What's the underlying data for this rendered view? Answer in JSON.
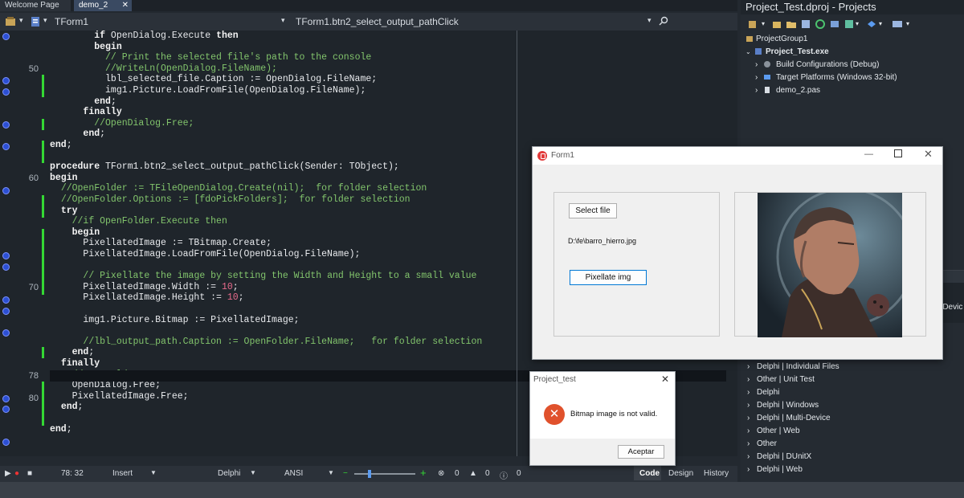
{
  "tabs": {
    "welcome": "Welcome Page",
    "active": "demo_2",
    "close": "✕"
  },
  "editor_bar": {
    "unit": "TForm1",
    "method": "TForm1.btn2_select_output_pathClick"
  },
  "gutter": {
    "n50": "50",
    "n60": "60",
    "n70": "70",
    "n78": "78",
    "n80": "80"
  },
  "code": [
    "        if OpenDialog.Execute then",
    "        begin",
    "          // Print the selected file's path to the console",
    "          //WriteLn(OpenDialog.FileName);",
    "          lbl_selected_file.Caption := OpenDialog.FileName;",
    "          img1.Picture.LoadFromFile(OpenDialog.FileName);",
    "        end;",
    "      finally",
    "        //OpenDialog.Free;",
    "      end;",
    "end;",
    "",
    "procedure TForm1.btn2_select_output_pathClick(Sender: TObject);",
    "begin",
    "  //OpenFolder := TFileOpenDialog.Create(nil);  for folder selection",
    "  //OpenFolder.Options := [fdoPickFolders];  for folder selection",
    "  try",
    "    //if OpenFolder.Execute then",
    "    begin",
    "      PixellatedImage := TBitmap.Create;",
    "      PixellatedImage.LoadFromFile(OpenDialog.FileName);",
    "",
    "      // Pixellate the image by setting the Width and Height to a small value",
    "      PixellatedImage.Width := 10;",
    "      PixellatedImage.Height := 10;",
    "",
    "      img1.Picture.Bitmap := PixellatedImage;",
    "",
    "      //lbl_output_path.Caption := OpenFolder.FileName;   for folder selection",
    "    end;",
    "  finally",
    "    //OpenFolder.Free;",
    "    OpenDialog.Free;",
    "    PixellatedImage.Free;",
    "  end;",
    "",
    "end;"
  ],
  "status": {
    "pos": "78: 32",
    "mode": "Insert",
    "lang": "Delphi",
    "enc": "ANSI",
    "c1": "0",
    "c2": "0",
    "c3": "0",
    "tab_code": "Code",
    "tab_design": "Design",
    "tab_history": "History"
  },
  "projects": {
    "title": "Project_Test.dproj - Projects",
    "group": "ProjectGroup1",
    "exe": "Project_Test.exe",
    "build": "Build Configurations (Debug)",
    "target": "Target Platforms (Windows 32-bit)",
    "unit": "demo_2.pas",
    "side_partial": "-Devic",
    "templates": [
      "Delphi | Individual Files",
      "Other | Unit Test",
      "Delphi",
      "Delphi | Windows",
      "Delphi | Multi-Device",
      "Other | Web",
      "Other",
      "Delphi | DUnitX",
      "Delphi | Web"
    ]
  },
  "form1": {
    "title": "Form1",
    "select_btn": "Select file",
    "path": "D:\\fe\\barro_hierro.jpg",
    "pix_btn": "Pixellate img"
  },
  "dialog": {
    "title": "Project_test",
    "message": "Bitmap image is not valid.",
    "ok": "Aceptar"
  }
}
